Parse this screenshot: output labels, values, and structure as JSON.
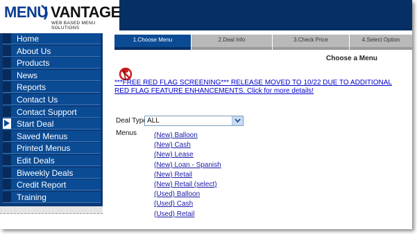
{
  "logo": {
    "word1": "MENU",
    "word2": "VANTAGE",
    "tagline": "WEB BASED MENU SOLUTIONS"
  },
  "sidebar": {
    "items": [
      {
        "label": "Home"
      },
      {
        "label": "About Us"
      },
      {
        "label": "Products"
      },
      {
        "label": "News"
      },
      {
        "label": "Reports"
      },
      {
        "label": "Contact Us"
      },
      {
        "label": "Contact Support"
      },
      {
        "label": "Start Deal",
        "active": true
      },
      {
        "label": "Saved Menus"
      },
      {
        "label": "Printed Menus"
      },
      {
        "label": "Edit Deals"
      },
      {
        "label": "Biweekly Deals"
      },
      {
        "label": "Credit Report"
      },
      {
        "label": "Training"
      }
    ]
  },
  "tabs": [
    {
      "label": "1.Choose Menu",
      "active": true
    },
    {
      "label": "2.Deal Info"
    },
    {
      "label": "3.Check Price"
    },
    {
      "label": "4.Select Option"
    }
  ],
  "main": {
    "title": "Choose a Menu",
    "alert_text": "***FREE RED FLAG SCREENING*** RELEASE MOVED TO 10/22 DUE TO ADDITIONAL RED FLAG FEATURE ENHANCEMENTS. Click for more details!",
    "deal_types_label": "Deal Types",
    "deal_types_value": "ALL",
    "menus_label": "Menus",
    "menus": [
      "(New) Balloon",
      "(New) Cash",
      "(New) Lease",
      "(New) Loan - Spanish",
      "(New) Retail",
      "(New) Retail (select)",
      "(Used) Balloon",
      "(Used) Cash",
      "(Used) Retail"
    ]
  },
  "colors": {
    "header_bg": "#062f66",
    "sidebar_item": "#0b4b94",
    "link": "#1a1aa8",
    "alert": "#0000cc",
    "flag_red": "#cc1a1a"
  }
}
